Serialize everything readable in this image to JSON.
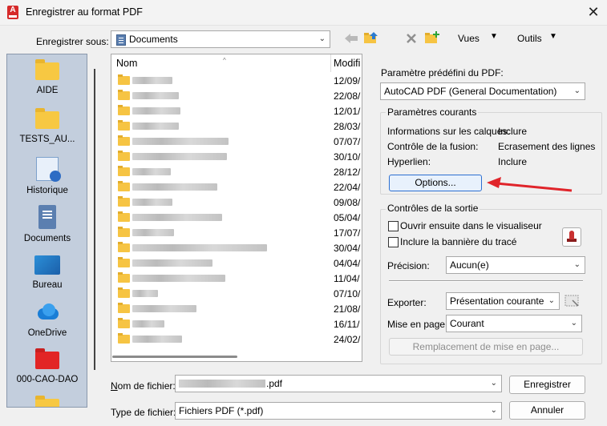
{
  "window": {
    "title": "Enregistrer au format PDF",
    "app_icon_letter": "A"
  },
  "top": {
    "save_in_label": "Enregistrer sous:",
    "save_in_value": "Documents",
    "views_label": "Vues",
    "tools_label": "Outils"
  },
  "places": [
    {
      "label": "AIDE",
      "icon": "folder-icon"
    },
    {
      "label": "TESTS_AU...",
      "icon": "folder-icon"
    },
    {
      "label": "Historique",
      "icon": "history-icon"
    },
    {
      "label": "Documents",
      "icon": "documents-icon"
    },
    {
      "label": "Bureau",
      "icon": "desktop-icon"
    },
    {
      "label": "OneDrive",
      "icon": "onedrive-icon"
    },
    {
      "label": "000-CAO-DAO",
      "icon": "red-folder-icon"
    }
  ],
  "filelist": {
    "col_name": "Nom",
    "col_modified": "Modifi",
    "rows": [
      {
        "date": "12/09/"
      },
      {
        "date": "22/08/"
      },
      {
        "date": "12/01/"
      },
      {
        "date": "28/03/"
      },
      {
        "date": "07/07/"
      },
      {
        "date": "30/10/"
      },
      {
        "date": "28/12/"
      },
      {
        "date": "22/04/"
      },
      {
        "date": "09/08/"
      },
      {
        "date": "05/04/"
      },
      {
        "date": "17/07/"
      },
      {
        "date": "30/04/"
      },
      {
        "date": "04/04/"
      },
      {
        "date": "11/04/"
      },
      {
        "date": "07/10/"
      },
      {
        "date": "21/08/"
      },
      {
        "date": "16/11/"
      },
      {
        "date": "24/02/"
      }
    ]
  },
  "bottom": {
    "filename_label": "Nom de fichier:",
    "filename_value": ".pdf",
    "filetype_label": "Type de fichier:",
    "filetype_value": "Fichiers PDF (*.pdf)",
    "save_button": "Enregistrer",
    "cancel_button": "Annuler"
  },
  "preset": {
    "label": "Paramètre prédéfini du PDF:",
    "value": "AutoCAD PDF (General Documentation)"
  },
  "current": {
    "title": "Paramètres courants",
    "rows": [
      {
        "k": "Informations sur les calques:",
        "v": "Inclure"
      },
      {
        "k": "Contrôle de la fusion:",
        "v": "Ecrasement des lignes"
      },
      {
        "k": "Hyperlien:",
        "v": "Inclure"
      }
    ],
    "options_button": "Options..."
  },
  "output": {
    "title": "Contrôles de la sortie",
    "open_viewer": "Ouvrir ensuite dans le visualiseur",
    "include_banner": "Inclure la bannière du tracé",
    "precision_label": "Précision:",
    "precision_value": "Aucun(e)",
    "export_label": "Exporter:",
    "export_value": "Présentation courante",
    "layout_label": "Mise en page:",
    "layout_value": "Courant",
    "replace_button": "Remplacement de mise en page..."
  },
  "colors": {
    "accent_arrow": "#e0242a",
    "places_bg": "#c3cedd"
  }
}
